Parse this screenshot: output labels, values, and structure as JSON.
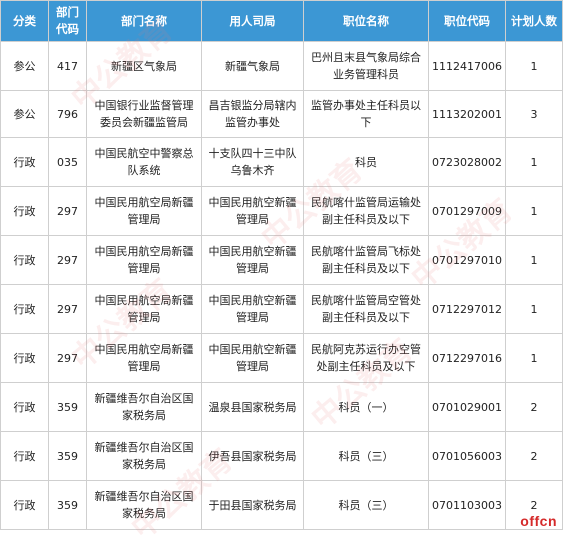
{
  "headers": [
    "分类",
    "部门代码",
    "部门名称",
    "用人司局",
    "职位名称",
    "职位代码",
    "计划人数"
  ],
  "rows": [
    [
      "参公",
      "417",
      "新疆区气象局",
      "新疆气象局",
      "巴州且末县气象局综合业务管理科员",
      "1112417006",
      "1"
    ],
    [
      "参公",
      "796",
      "中国银行业监督管理委员会新疆监管局",
      "昌吉银监分局辖内监管办事处",
      "监管办事处主任科员以下",
      "1113202001",
      "3"
    ],
    [
      "行政",
      "035",
      "中国民航空中警察总队系统",
      "十支队四十三中队乌鲁木齐",
      "科员",
      "0723028002",
      "1"
    ],
    [
      "行政",
      "297",
      "中国民用航空局新疆管理局",
      "中国民用航空新疆管理局",
      "民航喀什监管局运输处副主任科员及以下",
      "0701297009",
      "1"
    ],
    [
      "行政",
      "297",
      "中国民用航空局新疆管理局",
      "中国民用航空新疆管理局",
      "民航喀什监管局飞标处副主任科员及以下",
      "0701297010",
      "1"
    ],
    [
      "行政",
      "297",
      "中国民用航空局新疆管理局",
      "中国民用航空新疆管理局",
      "民航喀什监管局空管处副主任科员及以下",
      "0712297012",
      "1"
    ],
    [
      "行政",
      "297",
      "中国民用航空局新疆管理局",
      "中国民用航空新疆管理局",
      "民航阿克苏运行办空管处副主任科员及以下",
      "0712297016",
      "1"
    ],
    [
      "行政",
      "359",
      "新疆维吾尔自治区国家税务局",
      "温泉县国家税务局",
      "科员（一）",
      "0701029001",
      "2"
    ],
    [
      "行政",
      "359",
      "新疆维吾尔自治区国家税务局",
      "伊吾县国家税务局",
      "科员（三）",
      "0701056003",
      "2"
    ],
    [
      "行政",
      "359",
      "新疆维吾尔自治区国家税务局",
      "于田县国家税务局",
      "科员（三）",
      "0701103003",
      "2"
    ]
  ],
  "watermark_text": "中公教育",
  "logo_text": "offcn"
}
